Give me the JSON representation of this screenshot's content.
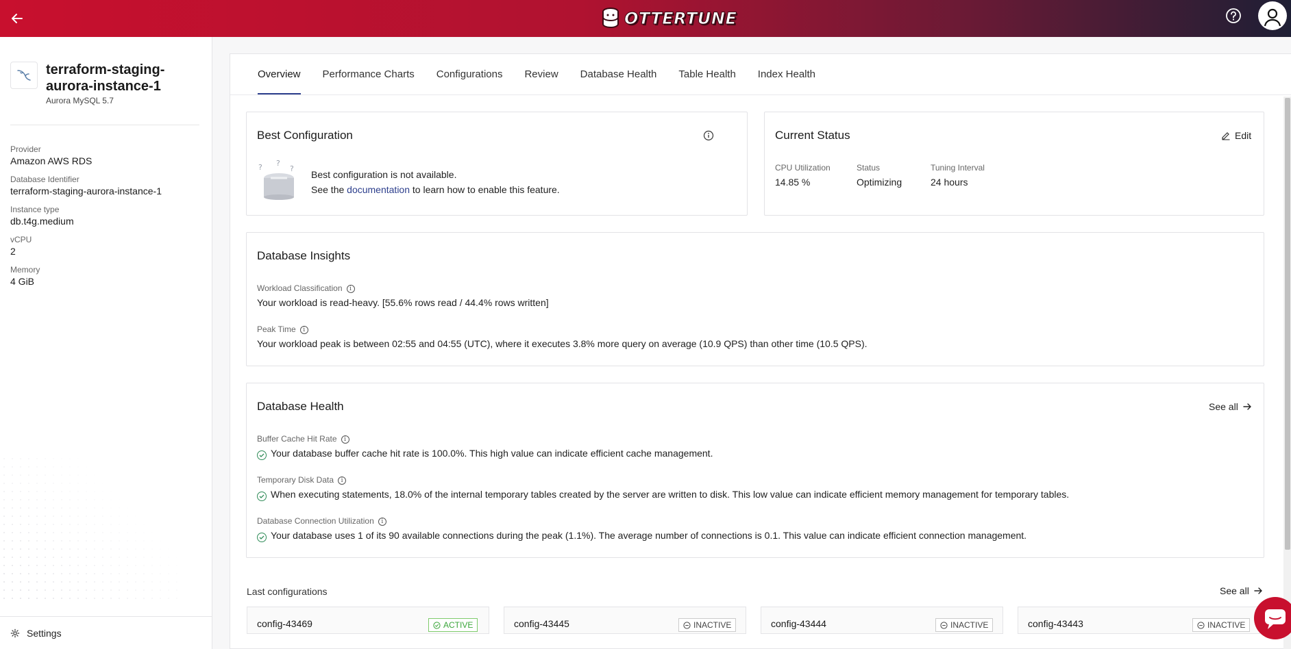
{
  "header": {
    "logo_text": "OTTERTUNE"
  },
  "sidebar": {
    "db_name": "terraform-staging-aurora-instance-1",
    "db_name_line1": "terraform-staging-",
    "db_name_line2": "aurora-instance-1",
    "db_engine": "Aurora MySQL 5.7",
    "details": [
      {
        "label": "Provider",
        "value": "Amazon AWS RDS"
      },
      {
        "label": "Database Identifier",
        "value": "terraform-staging-aurora-instance-1"
      },
      {
        "label": "Instance type",
        "value": "db.t4g.medium"
      },
      {
        "label": "vCPU",
        "value": "2"
      },
      {
        "label": "Memory",
        "value": "4 GiB"
      }
    ],
    "settings_label": "Settings"
  },
  "tabs": [
    {
      "label": "Overview",
      "active": true
    },
    {
      "label": "Performance Charts",
      "active": false
    },
    {
      "label": "Configurations",
      "active": false
    },
    {
      "label": "Review",
      "active": false
    },
    {
      "label": "Database Health",
      "active": false
    },
    {
      "label": "Table Health",
      "active": false
    },
    {
      "label": "Index Health",
      "active": false
    }
  ],
  "best_config": {
    "title": "Best Configuration",
    "line1": "Best configuration is not available.",
    "line2_prefix": "See the ",
    "line2_link": "documentation",
    "line2_suffix": " to learn how to enable this feature."
  },
  "current_status": {
    "title": "Current Status",
    "edit_label": "Edit",
    "fields": [
      {
        "label": "CPU Utilization",
        "value": "14.85 %"
      },
      {
        "label": "Status",
        "value": "Optimizing"
      },
      {
        "label": "Tuning Interval",
        "value": "24 hours"
      }
    ]
  },
  "insights": {
    "title": "Database Insights",
    "items": [
      {
        "label": "Workload Classification",
        "text": "Your workload is read-heavy. [55.6% rows read / 44.4% rows written]"
      },
      {
        "label": "Peak Time",
        "text": "Your workload peak is between 02:55 and 04:55 (UTC), where it executes 3.8% more query on average (10.9 QPS) than other time (10.5 QPS)."
      }
    ]
  },
  "health": {
    "title": "Database Health",
    "see_all": "See all",
    "items": [
      {
        "label": "Buffer Cache Hit Rate",
        "text": "Your database buffer cache hit rate is 100.0%. This high value can indicate efficient cache management."
      },
      {
        "label": "Temporary Disk Data",
        "text": "When executing statements, 18.0% of the internal temporary tables created by the server are written to disk. This low value can indicate efficient memory management for temporary tables."
      },
      {
        "label": "Database Connection Utilization",
        "text": "Your database uses 1 of its 90 available connections during the peak (1.1%). The average number of connections is 0.1. This value can indicate efficient connection management."
      }
    ]
  },
  "last_configs": {
    "title": "Last configurations",
    "see_all": "See all",
    "items": [
      {
        "name": "config-43469",
        "status": "ACTIVE"
      },
      {
        "name": "config-43445",
        "status": "INACTIVE"
      },
      {
        "name": "config-43444",
        "status": "INACTIVE"
      },
      {
        "name": "config-43443",
        "status": "INACTIVE"
      }
    ]
  },
  "colors": {
    "brand_red": "#c8102e",
    "nav_accent": "#2c3e8c",
    "success_green": "#2e8b57"
  }
}
